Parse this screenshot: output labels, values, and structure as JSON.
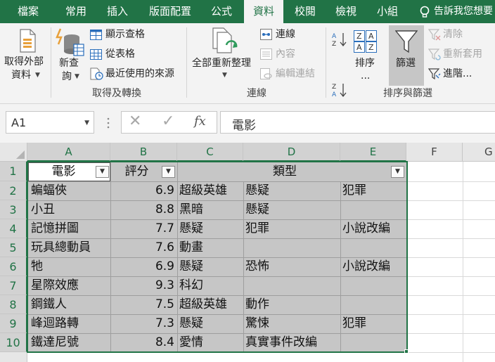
{
  "tabs": [
    {
      "label": "檔案",
      "active": false
    },
    {
      "label": "常用",
      "active": false
    },
    {
      "label": "插入",
      "active": false
    },
    {
      "label": "版面配置",
      "active": false
    },
    {
      "label": "公式",
      "active": false
    },
    {
      "label": "資料",
      "active": true
    },
    {
      "label": "校閱",
      "active": false
    },
    {
      "label": "檢視",
      "active": false
    },
    {
      "label": "小組",
      "active": false
    }
  ],
  "tell_me": "告訴我您想要",
  "ribbon": {
    "get_external_data": {
      "line1": "取得外部",
      "line2": "資料"
    },
    "new_query": {
      "line1": "新查",
      "line2": "詢"
    },
    "show_queries": "顯示查格",
    "from_table": "從表格",
    "recent_sources": "最近使用的來源",
    "group_get_transform": "取得及轉換",
    "refresh_all": "全部重新整理",
    "connections": "連線",
    "properties": "內容",
    "edit_links": "編輯連結",
    "group_connections": "連線",
    "sort": "排序",
    "sort_dots": "...",
    "filter": "篩選",
    "clear": "清除",
    "reapply": "重新套用",
    "advanced": "進階...",
    "group_sort_filter": "排序與篩選"
  },
  "formula_bar": {
    "name_box": "A1",
    "fx": "fx",
    "value": "電影"
  },
  "columns": [
    "A",
    "B",
    "C",
    "D",
    "E",
    "F",
    "G"
  ],
  "rows": [
    "1",
    "2",
    "3",
    "4",
    "5",
    "6",
    "7",
    "8",
    "9",
    "10"
  ],
  "table": {
    "headers": {
      "A": "電影",
      "B": "評分",
      "CDE": "類型"
    },
    "records": [
      {
        "A": "蝙蝠俠",
        "B": "6.9",
        "C": "超級英雄",
        "D": "懸疑",
        "E": "犯罪"
      },
      {
        "A": "小丑",
        "B": "8.8",
        "C": "黑暗",
        "D": "懸疑",
        "E": ""
      },
      {
        "A": "記憶拼圖",
        "B": "7.7",
        "C": "懸疑",
        "D": "犯罪",
        "E": "小說改編"
      },
      {
        "A": "玩具總動員",
        "B": "7.6",
        "C": "動畫",
        "D": "",
        "E": ""
      },
      {
        "A": "牠",
        "B": "6.9",
        "C": "懸疑",
        "D": "恐怖",
        "E": "小說改編"
      },
      {
        "A": "星際效應",
        "B": "9.3",
        "C": "科幻",
        "D": "",
        "E": ""
      },
      {
        "A": "鋼鐵人",
        "B": "7.5",
        "C": "超級英雄",
        "D": "動作",
        "E": ""
      },
      {
        "A": "峰迴路轉",
        "B": "7.3",
        "C": "懸疑",
        "D": "驚悚",
        "E": "犯罪"
      },
      {
        "A": "鐵達尼號",
        "B": "8.4",
        "C": "愛情",
        "D": "真實事件改編",
        "E": ""
      }
    ]
  },
  "colors": {
    "brand_green": "#217346",
    "selection_fill": "#c6c6c6",
    "ribbon_bg": "#f3f3f3"
  },
  "icons": [
    "lightbulb-icon",
    "external-data-icon",
    "new-query-icon",
    "show-queries-icon",
    "from-table-icon",
    "recent-sources-icon",
    "refresh-all-icon",
    "connections-icon",
    "properties-icon",
    "edit-links-icon",
    "sort-az-icon",
    "sort-za-icon",
    "sort-icon",
    "filter-icon",
    "clear-filter-icon",
    "reapply-icon",
    "advanced-filter-icon",
    "filter-dropdown-icon"
  ]
}
